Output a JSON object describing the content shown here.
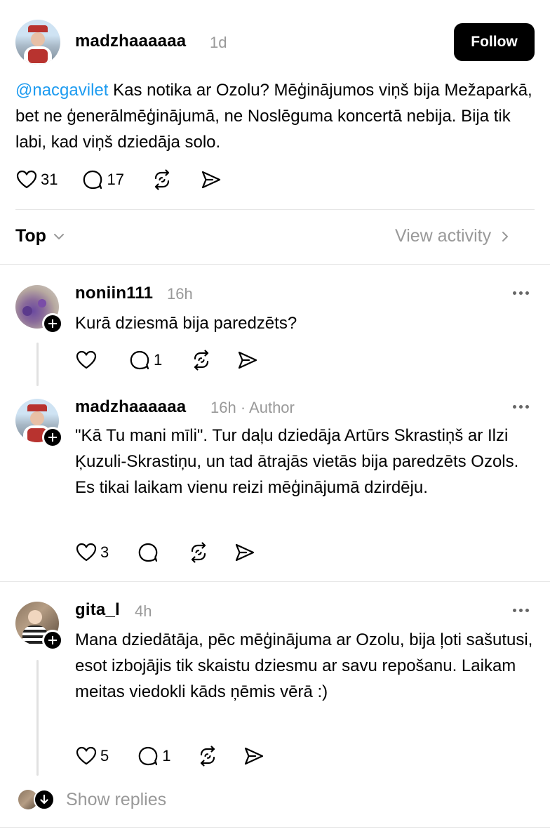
{
  "post": {
    "username": "madzhaaaaaa",
    "time": "1d",
    "follow_label": "Follow",
    "mention": "@nacgavilet",
    "text": " Kas notika ar Ozolu? Mēģinājumos viņš bija Mežaparkā, bet ne ģenerālmēģinājumā, ne Noslēguma koncertā nebija. Bija tik labi, kad viņš dziedāja solo.",
    "likes": "31",
    "replies": "17"
  },
  "sort": {
    "label": "Top",
    "view_activity": "View activity"
  },
  "replies": [
    {
      "username": "noniin111",
      "time": "16h",
      "text": "Kurā dziesmā bija paredzēts?",
      "likes": "",
      "replies": "1"
    },
    {
      "username": "madzhaaaaaa",
      "time": "16h · Author",
      "text": "\"Kā Tu mani mīli\". Tur daļu dziedāja Artūrs Skrastiņš ar Ilzi Ķuzuli-Skrastiņu, un tad ātrajās vietās bija paredzēts Ozols. Es tikai laikam vienu reizi mēģinājumā dzirdēju.",
      "likes": "3",
      "replies": ""
    },
    {
      "username": "gita_l",
      "time": "4h",
      "text": "Mana dziedātāja, pēc mēģinājuma ar Ozolu, bija ļoti sašutusi, esot izbojājis tik skaistu dziesmu ar savu repošanu. Laikam meitas viedokli kāds ņēmis vērā :)",
      "likes": "5",
      "replies": "1"
    }
  ],
  "show_replies": "Show replies",
  "colors": {
    "mention": "#1d9bf0",
    "meta": "#999999",
    "divider": "#e6e6e6"
  }
}
